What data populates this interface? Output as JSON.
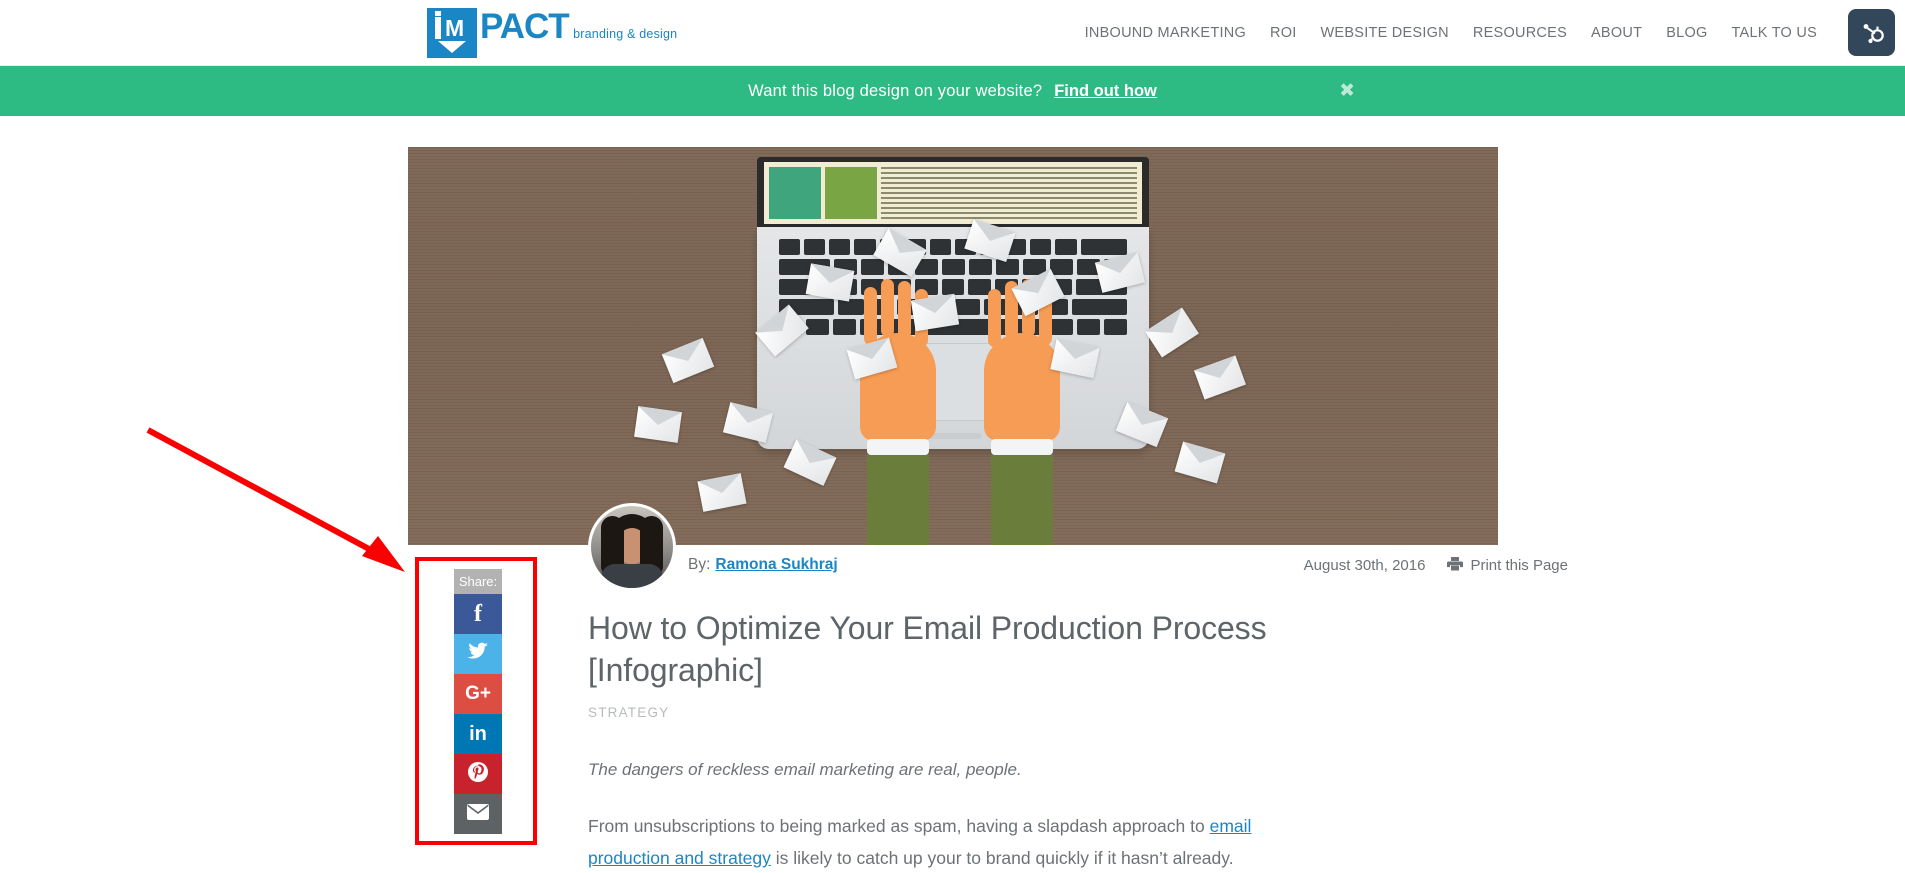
{
  "header": {
    "logo": {
      "mark_letters": "iM",
      "wordmark": "PACT",
      "tagline": "branding & design"
    },
    "nav": [
      {
        "label": "INBOUND MARKETING"
      },
      {
        "label": "ROI"
      },
      {
        "label": "WEBSITE DESIGN"
      },
      {
        "label": "RESOURCES"
      },
      {
        "label": "ABOUT"
      },
      {
        "label": "BLOG"
      },
      {
        "label": "TALK TO US"
      }
    ],
    "hubspot_icon": "hubspot-sprocket-icon"
  },
  "promo_banner": {
    "text": "Want this blog design on your website?",
    "link_label": "Find out how",
    "close_label": "✖",
    "background": "#2dba83"
  },
  "hero": {
    "alt": "Flat illustration of hands typing on a laptop on a wooden desk with envelopes flying out",
    "desk_color": "#7a6352",
    "laptop_color": "#e4e6e8"
  },
  "share_bar": {
    "label": "Share:",
    "buttons": [
      {
        "name": "facebook",
        "glyph": "f",
        "color": "#3b5998"
      },
      {
        "name": "twitter",
        "glyph": "twitter-bird",
        "color": "#4cb3e8"
      },
      {
        "name": "google-plus",
        "glyph": "G+",
        "color": "#dc4e41"
      },
      {
        "name": "linkedin",
        "glyph": "in",
        "color": "#0077b5"
      },
      {
        "name": "pinterest",
        "glyph": "pinterest-p",
        "color": "#c8232c"
      },
      {
        "name": "email",
        "glyph": "envelope",
        "color": "#5d6265"
      }
    ],
    "highlight_color": "#fb0000"
  },
  "annotation": {
    "arrow_color": "#fb0000",
    "arrow_target": "share-bar"
  },
  "article": {
    "by_label": "By:",
    "author": "Ramona Sukhraj",
    "date": "August 30th, 2016",
    "print_label": "Print this Page",
    "title": "How to Optimize Your Email Production Process [Infographic]",
    "category": "STRATEGY",
    "lede": "The dangers of reckless email marketing are real, people.",
    "paragraph_before_link": "From unsubscriptions to being marked as spam, having a slapdash approach to ",
    "paragraph_link": "email production and strategy",
    "paragraph_after_link": " is likely to catch up your to brand quickly if it hasn’t already."
  }
}
